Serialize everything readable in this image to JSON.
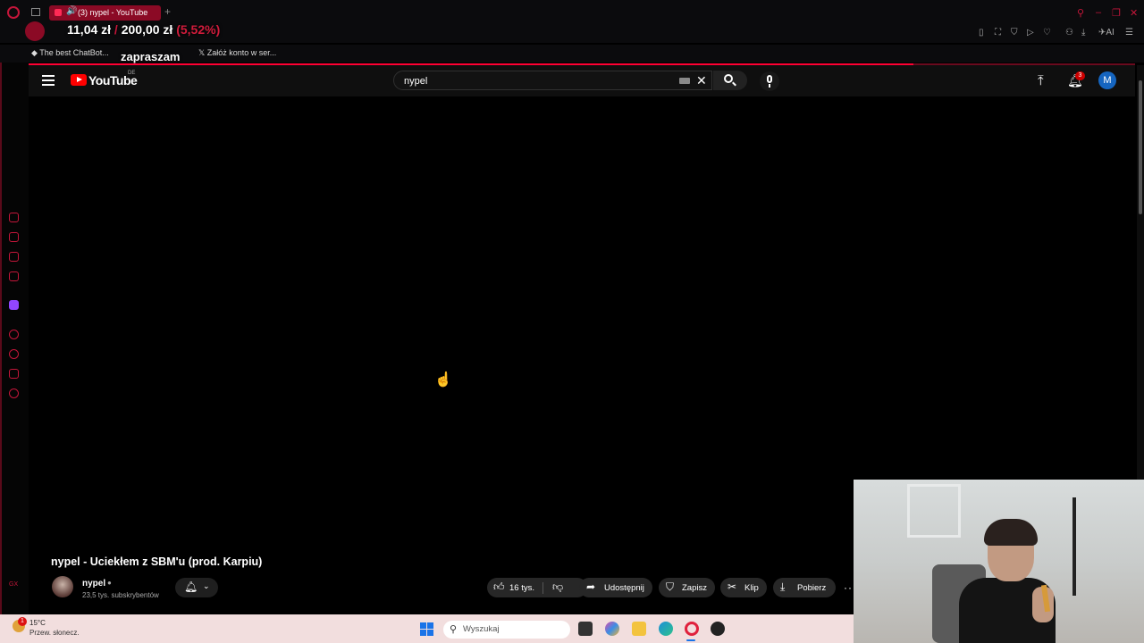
{
  "browser": {
    "tab_title": "(3) nypel - YouTube",
    "bookmarks": [
      "The best ChatBot...",
      "Załóż konto w ser..."
    ],
    "overlay_price": "11,04 zł",
    "overlay_sep": " / ",
    "overlay_total": "200,00 zł",
    "overlay_pct": "(5,52%)",
    "overlay_caption": "zapraszam"
  },
  "youtube": {
    "logo_text": "YouTube",
    "country": "DE",
    "search_value": "nypel",
    "notification_count": "3",
    "avatar_letter": "M"
  },
  "video": {
    "progress_fraction": 0.8,
    "title": "nypel - Uciekłem z SBM'u (prod. Karpiu)",
    "channel_name": "nypel",
    "subscribers": "23,5 tys. subskrybentów",
    "likes": "16 tys.",
    "share_label": "Udostępnij",
    "save_label": "Zapisz",
    "clip_label": "Klip",
    "download_label": "Pobierz"
  },
  "taskbar": {
    "temperature": "15°C",
    "weather": "Przew. słonecz.",
    "weather_badge": "1",
    "search_placeholder": "Wyszukaj"
  },
  "colors": {
    "accent": "#c4163a",
    "youtube_red": "#ff0000",
    "taskbar_bg": "#f2dede"
  }
}
